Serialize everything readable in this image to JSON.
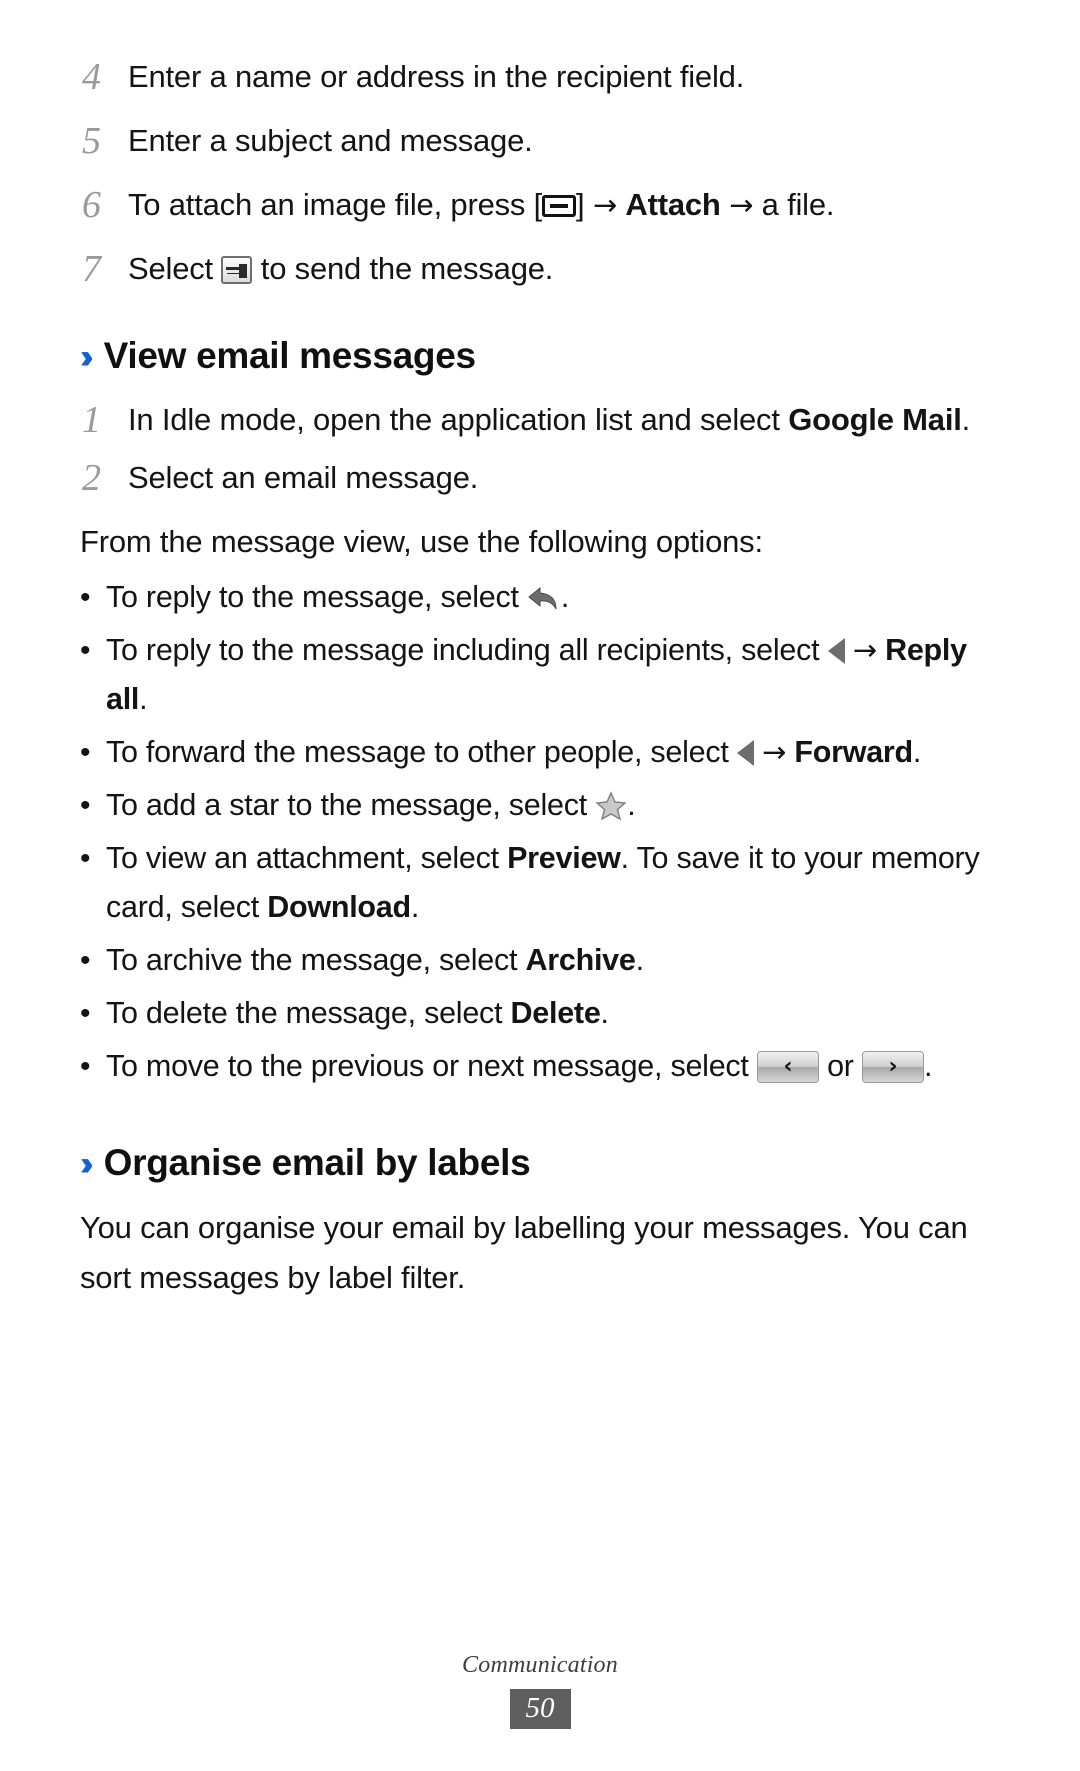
{
  "document": {
    "footer_title": "Communication",
    "page_number": "50",
    "accent_color": "#1262d6"
  },
  "steps_top": [
    {
      "num": "4",
      "text": "Enter a name or address in the recipient field."
    },
    {
      "num": "5",
      "text": "Enter a subject and message."
    },
    {
      "num": "6",
      "text_before": "To attach an image file, press [",
      "text_mid": "] ",
      "arrow1": "→",
      "bold1": "Attach",
      "arrow2": "→",
      "text_after": " a file."
    },
    {
      "num": "7",
      "text_before": "Select ",
      "text_after": " to send the message."
    }
  ],
  "section_view": {
    "chevron": "››",
    "heading": "View email messages",
    "steps": [
      {
        "num": "1",
        "text_before": "In Idle mode, open the application list and select ",
        "bold": "Google Mail",
        "text_after": "."
      },
      {
        "num": "2",
        "text": "Select an email message."
      }
    ],
    "intro": "From the message view, use the following options:",
    "bullets": [
      {
        "id": "reply",
        "text_before": "To reply to the message, select ",
        "icon": "reply-arrow-icon",
        "text_after": "."
      },
      {
        "id": "reply-all",
        "text_before": "To reply to the message including all recipients, select ",
        "icon": "left-triangle-icon",
        "arrow": "→",
        "bold": "Reply all",
        "text_after": "."
      },
      {
        "id": "forward",
        "text_before": "To forward the message to other people, select ",
        "icon": "left-triangle-icon",
        "arrow": "→",
        "bold": "Forward",
        "text_after": "."
      },
      {
        "id": "star",
        "text_before": "To add a star to the message, select ",
        "icon": "star-icon",
        "text_after": "."
      },
      {
        "id": "attachment",
        "text_before": "To view an attachment, select ",
        "bold": "Preview",
        "text_mid": ". To save it to your memory card, select ",
        "bold2": "Download",
        "text_after": "."
      },
      {
        "id": "archive",
        "text_before": "To archive the message, select ",
        "bold": "Archive",
        "text_after": "."
      },
      {
        "id": "delete",
        "text_before": "To delete the message, select ",
        "bold": "Delete",
        "text_after": "."
      },
      {
        "id": "prev-next",
        "text_before": "To move to the previous or next message, select ",
        "icon_prev": "previous-message-button",
        "icon_prev_glyph": "‹",
        "text_mid": " or ",
        "icon_next": "next-message-button",
        "icon_next_glyph": "›",
        "text_after": "."
      }
    ]
  },
  "section_organise": {
    "chevron": "››",
    "heading": "Organise email by labels",
    "paragraph": "You can organise your email by labelling your messages. You can sort messages by label filter."
  }
}
